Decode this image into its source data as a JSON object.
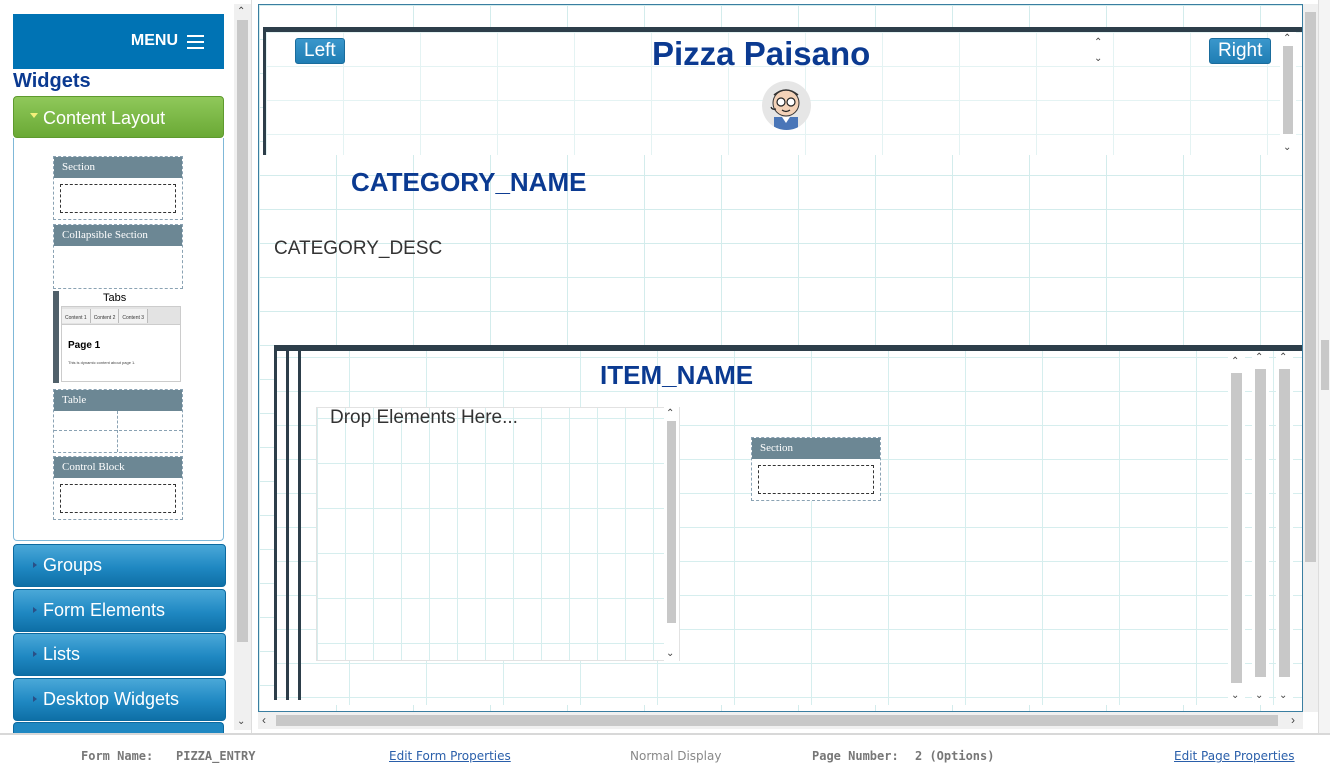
{
  "left_panel": {
    "menu_label": "MENU",
    "widgets_title": "Widgets",
    "content_layout": {
      "label": "Content Layout",
      "tiles": {
        "section": "Section",
        "collapsible": "Collapsible Section",
        "tabs": "Tabs",
        "tabs_preview": {
          "tab1": "Content 1",
          "tab2": "Content 2",
          "tab3": "Content 3",
          "page": "Page 1",
          "text": "This is dynamic content about page 1."
        },
        "table": "Table",
        "control_block": "Control Block"
      }
    },
    "accordion": [
      "Groups",
      "Form Elements",
      "Lists",
      "Desktop Widgets"
    ]
  },
  "canvas": {
    "left_button": "Left",
    "right_button": "Right",
    "title": "Pizza Paisano",
    "category_name": "CATEGORY_NAME",
    "category_desc": "CATEGORY_DESC",
    "item_name": "ITEM_NAME",
    "drop_text": "Drop Elements Here...",
    "section_widget": "Section"
  },
  "status_bar": {
    "form_name_label": "Form Name:",
    "form_name_value": "PIZZA_ENTRY",
    "edit_form_link": "Edit Form Properties",
    "display_mode": "Normal Display",
    "page_number_label": "Page Number:",
    "page_number_value": "2 (Options)",
    "edit_page_link": "Edit Page Properties"
  },
  "colors": {
    "title_blue": "#0b3a91",
    "menu_blue": "#0073b4",
    "accordion_blue": "#1f88c2",
    "content_layout_green": "#7bbb45",
    "section_header": "#6c8794"
  }
}
